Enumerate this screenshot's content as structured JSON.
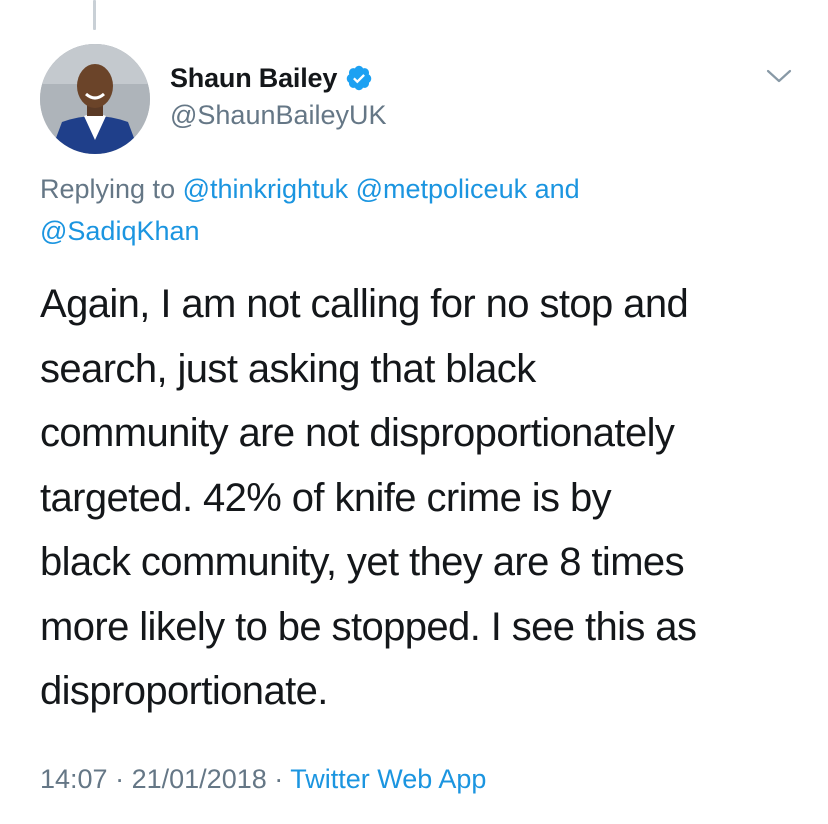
{
  "author": {
    "display_name": "Shaun Bailey",
    "handle": "@ShaunBaileyUK",
    "verified": true
  },
  "icons": {
    "verified": "verified-badge-icon",
    "menu": "chevron-down-icon"
  },
  "reply": {
    "prefix": "Replying to",
    "mention_1": "@thinkrightuk",
    "mention_2": "@metpoliceuk",
    "conjunction": "and",
    "mention_3": "@SadiqKhan"
  },
  "tweet": {
    "lines": [
      "Again, I am not calling for no stop and",
      "search, just asking that black",
      "community are not disproportionately",
      "targeted. 42% of knife crime is by",
      "black community, yet they are 8 times",
      "more likely to be stopped. I see this as",
      "disproportionate."
    ]
  },
  "meta": {
    "time": "14:07",
    "date": "21/01/2018",
    "separator": "·",
    "source": "Twitter Web App"
  },
  "colors": {
    "text": "#14171a",
    "secondary": "#657786",
    "link": "#1b95e0",
    "verified": "#1da1f2",
    "thread_line": "#c9d0d6"
  }
}
